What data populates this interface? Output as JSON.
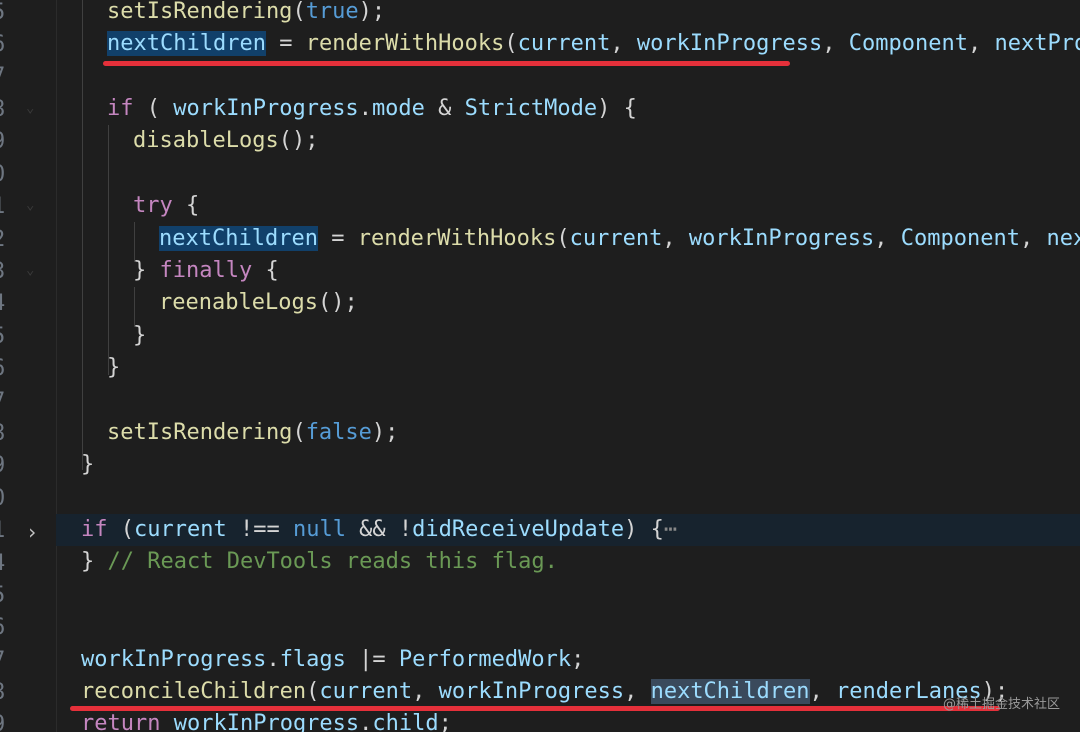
{
  "line_numbers": [
    "5",
    "6",
    "7",
    "8",
    "9",
    "0",
    "1",
    "2",
    "3",
    "4",
    "5",
    "6",
    "7",
    "8",
    "9",
    "0",
    "1",
    "4",
    "5",
    "6",
    "7",
    "8",
    "9"
  ],
  "code": {
    "l1": {
      "a": "setIsRendering",
      "b": "(",
      "c": "true",
      "d": ");"
    },
    "l2": {
      "a": "nextChildren",
      "b": " = ",
      "c": "renderWithHooks",
      "d": "(",
      "e": "current",
      ",": ", ",
      "f": "workInProgress",
      "g": "Component",
      "h": "nextProp"
    },
    "l4": {
      "a": "if",
      "b": " ( ",
      "c": "workInProgress",
      "d": ".",
      "e": "mode",
      "f": " & ",
      "g": "StrictMode",
      "h": ") {"
    },
    "l5": {
      "a": "disableLogs",
      "b": "();"
    },
    "l7": {
      "a": "try",
      "b": " {"
    },
    "l8": {
      "a": "nextChildren",
      "b": " = ",
      "c": "renderWithHooks",
      "d": "(",
      "e": "current",
      "f": "workInProgress",
      "g": "Component",
      "h": "next"
    },
    "l9": {
      "a": "} ",
      "b": "finally",
      "c": " {"
    },
    "l10": {
      "a": "reenableLogs",
      "b": "();"
    },
    "l11": "}",
    "l12": "}",
    "l14": {
      "a": "setIsRendering",
      "b": "(",
      "c": "false",
      "d": ");"
    },
    "l15": "}",
    "l17": {
      "a": "if",
      "b": " (",
      "c": "current",
      "d": " !== ",
      "e": "null",
      "f": " && !",
      "g": "didReceiveUpdate",
      "h": ") {",
      "i": "⋯"
    },
    "l18": {
      "a": "} ",
      "b": "// React DevTools reads this flag."
    },
    "l21": {
      "a": "workInProgress",
      "b": ".",
      "c": "flags",
      "d": " |= ",
      "e": "PerformedWork",
      "f": ";"
    },
    "l22": {
      "a": "reconcileChildren",
      "b": "(",
      "c": "current",
      "d": ", ",
      "e": "workInProgress",
      "f": ", ",
      "g": "nextChildren",
      "h": ", ",
      "i": "renderLanes",
      "j": ");"
    },
    "l23": {
      "a": "return",
      "b": " ",
      "c": "workInProgress",
      "d": ".",
      "e": "child",
      "f": ";"
    }
  },
  "watermark": "@稀土掘金技术社区",
  "colors": {
    "annotation_underline": "#e5303a",
    "background": "#1e1e1e"
  }
}
